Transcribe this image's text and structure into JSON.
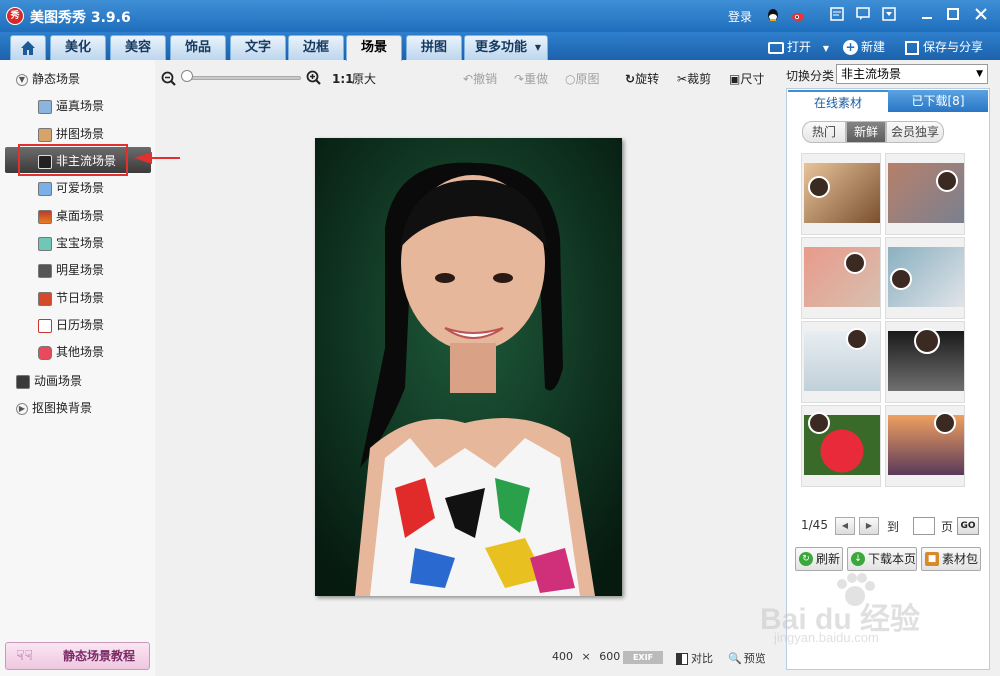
{
  "app": {
    "logo_text": "秀",
    "title": "美图秀秀 3.9.6"
  },
  "titlebar": {
    "login": "登录"
  },
  "nav": {
    "tabs": [
      {
        "label": "美化"
      },
      {
        "label": "美容"
      },
      {
        "label": "饰品"
      },
      {
        "label": "文字"
      },
      {
        "label": "边框"
      },
      {
        "label": "场景"
      },
      {
        "label": "拼图"
      },
      {
        "label": "更多功能"
      }
    ],
    "active_tab": "场景",
    "open": "打开",
    "new": "新建",
    "save_share": "保存与分享"
  },
  "sidebar": {
    "static_group": "静态场景",
    "items": [
      {
        "label": "逼真场景"
      },
      {
        "label": "拼图场景"
      },
      {
        "label": "非主流场景"
      },
      {
        "label": "可爱场景"
      },
      {
        "label": "桌面场景"
      },
      {
        "label": "宝宝场景"
      },
      {
        "label": "明星场景"
      },
      {
        "label": "节日场景"
      },
      {
        "label": "日历场景"
      },
      {
        "label": "其他场景"
      }
    ],
    "selected": "非主流场景",
    "animated_group": "动画场景",
    "cutout_group": "抠图换背景",
    "tutorial_button": "静态场景教程"
  },
  "toolbar": {
    "ratio": "1:1",
    "original_size": "原大",
    "undo": "撤销",
    "redo": "重做",
    "original": "原图",
    "rotate": "旋转",
    "crop": "裁剪",
    "size": "尺寸"
  },
  "canvas": {
    "width_value": "400",
    "times": "×",
    "height_value": "600",
    "exif": "EXIF",
    "compare": "对比",
    "preview": "预览"
  },
  "right_panel": {
    "switch_label": "切换分类",
    "category_value": "非主流场景",
    "tabs": {
      "online": "在线素材",
      "downloaded": "已下载[8]"
    },
    "subtabs": [
      "热门",
      "新鲜",
      "会员独享"
    ],
    "active_subtab": "新鲜",
    "pager": {
      "page": "1/45",
      "to": "到",
      "page_unit": "页",
      "go": "GO"
    },
    "buttons": {
      "refresh": "刷新",
      "download_page": "下载本页",
      "pack": "素材包"
    }
  },
  "watermark": {
    "brand": "Bai du 经验",
    "url": "jingyan.baidu.com"
  },
  "colors": {
    "title_blue": "#1e6fbd",
    "accent_red": "#e03030",
    "selected_dark": "#4a4a4a"
  }
}
